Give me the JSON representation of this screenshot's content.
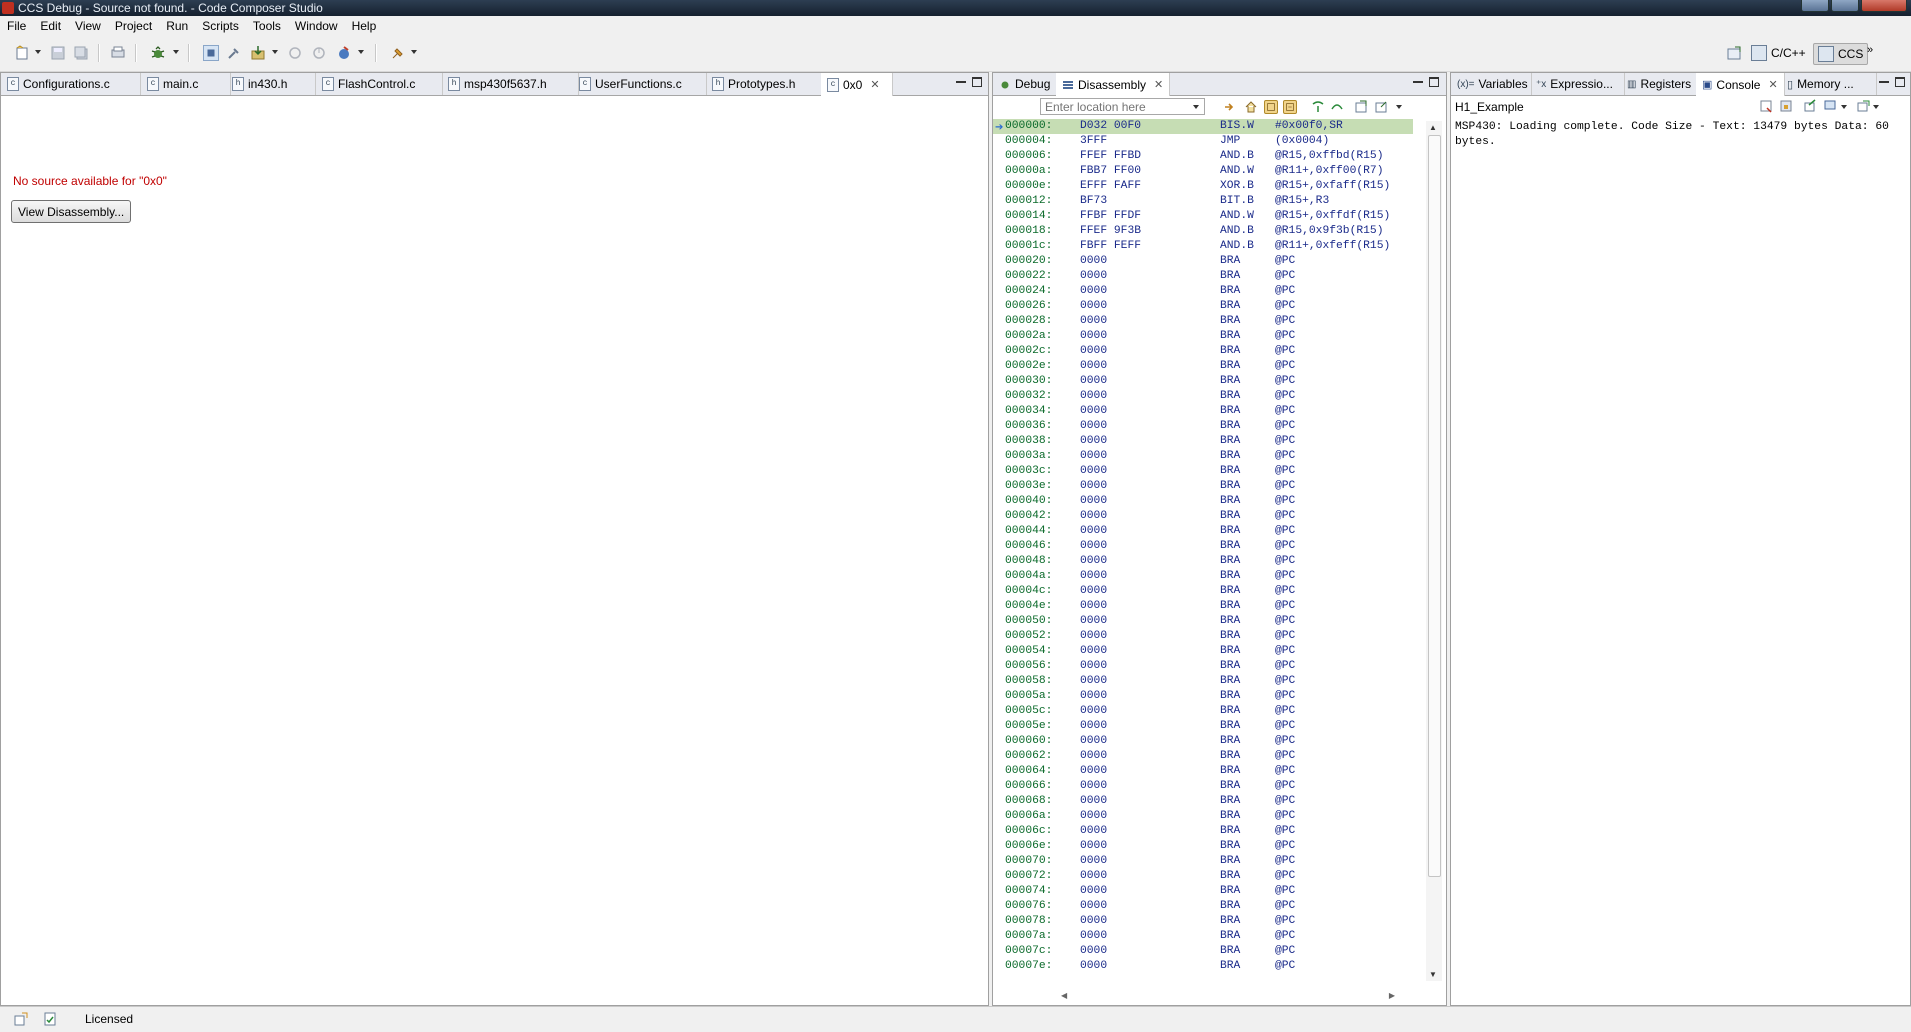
{
  "window": {
    "title": "CCS Debug - Source not found. - Code Composer Studio"
  },
  "menu": [
    "File",
    "Edit",
    "View",
    "Project",
    "Run",
    "Scripts",
    "Tools",
    "Window",
    "Help"
  ],
  "perspectives": [
    {
      "label": "C/C++",
      "active": false
    },
    {
      "label": "CCS",
      "active": true
    }
  ],
  "editor": {
    "tabs": [
      "Configurations.c",
      "main.c",
      "in430.h",
      "FlashControl.c",
      "msp430f5637.h",
      "UserFunctions.c",
      "Prototypes.h",
      "0x0"
    ],
    "active_tab": "0x0",
    "message": "No source available for \"0x0\"",
    "button_label": "View Disassembly..."
  },
  "debug_panel": {
    "tabs": [
      "Debug",
      "Disassembly"
    ],
    "active_tab": "Disassembly",
    "location_placeholder": "Enter location here",
    "lines": [
      {
        "addr": "000000:",
        "op": "D032 00F0",
        "mn": "BIS.W",
        "arg": "#0x00f0,SR",
        "current": true
      },
      {
        "addr": "000004:",
        "op": "3FFF",
        "mn": "JMP",
        "arg": "(0x0004)"
      },
      {
        "addr": "000006:",
        "op": "FFEF FFBD",
        "mn": "AND.B",
        "arg": "@R15,0xffbd(R15)"
      },
      {
        "addr": "00000a:",
        "op": "FBB7 FF00",
        "mn": "AND.W",
        "arg": "@R11+,0xff00(R7)"
      },
      {
        "addr": "00000e:",
        "op": "EFFF FAFF",
        "mn": "XOR.B",
        "arg": "@R15+,0xfaff(R15)"
      },
      {
        "addr": "000012:",
        "op": "BF73",
        "mn": "BIT.B",
        "arg": "@R15+,R3"
      },
      {
        "addr": "000014:",
        "op": "FFBF FFDF",
        "mn": "AND.W",
        "arg": "@R15+,0xffdf(R15)"
      },
      {
        "addr": "000018:",
        "op": "FFEF 9F3B",
        "mn": "AND.B",
        "arg": "@R15,0x9f3b(R15)"
      },
      {
        "addr": "00001c:",
        "op": "FBFF FEFF",
        "mn": "AND.B",
        "arg": "@R11+,0xfeff(R15)"
      },
      {
        "addr": "000020:",
        "op": "0000",
        "mn": "BRA",
        "arg": "@PC"
      },
      {
        "addr": "000022:",
        "op": "0000",
        "mn": "BRA",
        "arg": "@PC"
      },
      {
        "addr": "000024:",
        "op": "0000",
        "mn": "BRA",
        "arg": "@PC"
      },
      {
        "addr": "000026:",
        "op": "0000",
        "mn": "BRA",
        "arg": "@PC"
      },
      {
        "addr": "000028:",
        "op": "0000",
        "mn": "BRA",
        "arg": "@PC"
      },
      {
        "addr": "00002a:",
        "op": "0000",
        "mn": "BRA",
        "arg": "@PC"
      },
      {
        "addr": "00002c:",
        "op": "0000",
        "mn": "BRA",
        "arg": "@PC"
      },
      {
        "addr": "00002e:",
        "op": "0000",
        "mn": "BRA",
        "arg": "@PC"
      },
      {
        "addr": "000030:",
        "op": "0000",
        "mn": "BRA",
        "arg": "@PC"
      },
      {
        "addr": "000032:",
        "op": "0000",
        "mn": "BRA",
        "arg": "@PC"
      },
      {
        "addr": "000034:",
        "op": "0000",
        "mn": "BRA",
        "arg": "@PC"
      },
      {
        "addr": "000036:",
        "op": "0000",
        "mn": "BRA",
        "arg": "@PC"
      },
      {
        "addr": "000038:",
        "op": "0000",
        "mn": "BRA",
        "arg": "@PC"
      },
      {
        "addr": "00003a:",
        "op": "0000",
        "mn": "BRA",
        "arg": "@PC"
      },
      {
        "addr": "00003c:",
        "op": "0000",
        "mn": "BRA",
        "arg": "@PC"
      },
      {
        "addr": "00003e:",
        "op": "0000",
        "mn": "BRA",
        "arg": "@PC"
      },
      {
        "addr": "000040:",
        "op": "0000",
        "mn": "BRA",
        "arg": "@PC"
      },
      {
        "addr": "000042:",
        "op": "0000",
        "mn": "BRA",
        "arg": "@PC"
      },
      {
        "addr": "000044:",
        "op": "0000",
        "mn": "BRA",
        "arg": "@PC"
      },
      {
        "addr": "000046:",
        "op": "0000",
        "mn": "BRA",
        "arg": "@PC"
      },
      {
        "addr": "000048:",
        "op": "0000",
        "mn": "BRA",
        "arg": "@PC"
      },
      {
        "addr": "00004a:",
        "op": "0000",
        "mn": "BRA",
        "arg": "@PC"
      },
      {
        "addr": "00004c:",
        "op": "0000",
        "mn": "BRA",
        "arg": "@PC"
      },
      {
        "addr": "00004e:",
        "op": "0000",
        "mn": "BRA",
        "arg": "@PC"
      },
      {
        "addr": "000050:",
        "op": "0000",
        "mn": "BRA",
        "arg": "@PC"
      },
      {
        "addr": "000052:",
        "op": "0000",
        "mn": "BRA",
        "arg": "@PC"
      },
      {
        "addr": "000054:",
        "op": "0000",
        "mn": "BRA",
        "arg": "@PC"
      },
      {
        "addr": "000056:",
        "op": "0000",
        "mn": "BRA",
        "arg": "@PC"
      },
      {
        "addr": "000058:",
        "op": "0000",
        "mn": "BRA",
        "arg": "@PC"
      },
      {
        "addr": "00005a:",
        "op": "0000",
        "mn": "BRA",
        "arg": "@PC"
      },
      {
        "addr": "00005c:",
        "op": "0000",
        "mn": "BRA",
        "arg": "@PC"
      },
      {
        "addr": "00005e:",
        "op": "0000",
        "mn": "BRA",
        "arg": "@PC"
      },
      {
        "addr": "000060:",
        "op": "0000",
        "mn": "BRA",
        "arg": "@PC"
      },
      {
        "addr": "000062:",
        "op": "0000",
        "mn": "BRA",
        "arg": "@PC"
      },
      {
        "addr": "000064:",
        "op": "0000",
        "mn": "BRA",
        "arg": "@PC"
      },
      {
        "addr": "000066:",
        "op": "0000",
        "mn": "BRA",
        "arg": "@PC"
      },
      {
        "addr": "000068:",
        "op": "0000",
        "mn": "BRA",
        "arg": "@PC"
      },
      {
        "addr": "00006a:",
        "op": "0000",
        "mn": "BRA",
        "arg": "@PC"
      },
      {
        "addr": "00006c:",
        "op": "0000",
        "mn": "BRA",
        "arg": "@PC"
      },
      {
        "addr": "00006e:",
        "op": "0000",
        "mn": "BRA",
        "arg": "@PC"
      },
      {
        "addr": "000070:",
        "op": "0000",
        "mn": "BRA",
        "arg": "@PC"
      },
      {
        "addr": "000072:",
        "op": "0000",
        "mn": "BRA",
        "arg": "@PC"
      },
      {
        "addr": "000074:",
        "op": "0000",
        "mn": "BRA",
        "arg": "@PC"
      },
      {
        "addr": "000076:",
        "op": "0000",
        "mn": "BRA",
        "arg": "@PC"
      },
      {
        "addr": "000078:",
        "op": "0000",
        "mn": "BRA",
        "arg": "@PC"
      },
      {
        "addr": "00007a:",
        "op": "0000",
        "mn": "BRA",
        "arg": "@PC"
      },
      {
        "addr": "00007c:",
        "op": "0000",
        "mn": "BRA",
        "arg": "@PC"
      },
      {
        "addr": "00007e:",
        "op": "0000",
        "mn": "BRA",
        "arg": "@PC"
      }
    ]
  },
  "right_panel": {
    "tabs": [
      "Variables",
      "Expressio...",
      "Registers",
      "Console",
      "Memory ..."
    ],
    "active_tab": "Console",
    "console_title": "H1_Example",
    "console_text": "MSP430: Loading complete. Code Size - Text: 13479 bytes Data: 60 bytes."
  },
  "status": {
    "text": "Licensed"
  },
  "colors": {
    "current_line": "#c6ddb4",
    "address": "#0a6a2a",
    "instruction": "#1a2a8a",
    "error_text": "#c00000"
  }
}
